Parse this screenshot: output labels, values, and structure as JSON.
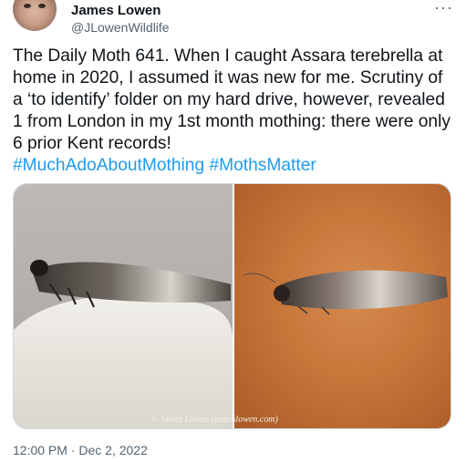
{
  "author": {
    "name": "James Lowen",
    "handle": "@JLowenWildlife"
  },
  "menu_icon": "more-horizontal-icon",
  "tweet": {
    "text": "The Daily Moth 641. When I caught Assara terebrella at home in 2020, I assumed it was new for me. Scrutiny of a ‘to identify’ folder on my hard drive, however, revealed 1 from London in my 1st month mothing: there were only 6 prior Kent records!",
    "hashtags": [
      "#MuchAdoAboutMothing",
      "#MothsMatter"
    ]
  },
  "media": {
    "watermark": "© James Lowen (jameslowen.com)"
  },
  "timestamp": "12:00 PM · Dec 2, 2022",
  "colors": {
    "link": "#1d9bf0",
    "secondary_text": "#536471"
  }
}
